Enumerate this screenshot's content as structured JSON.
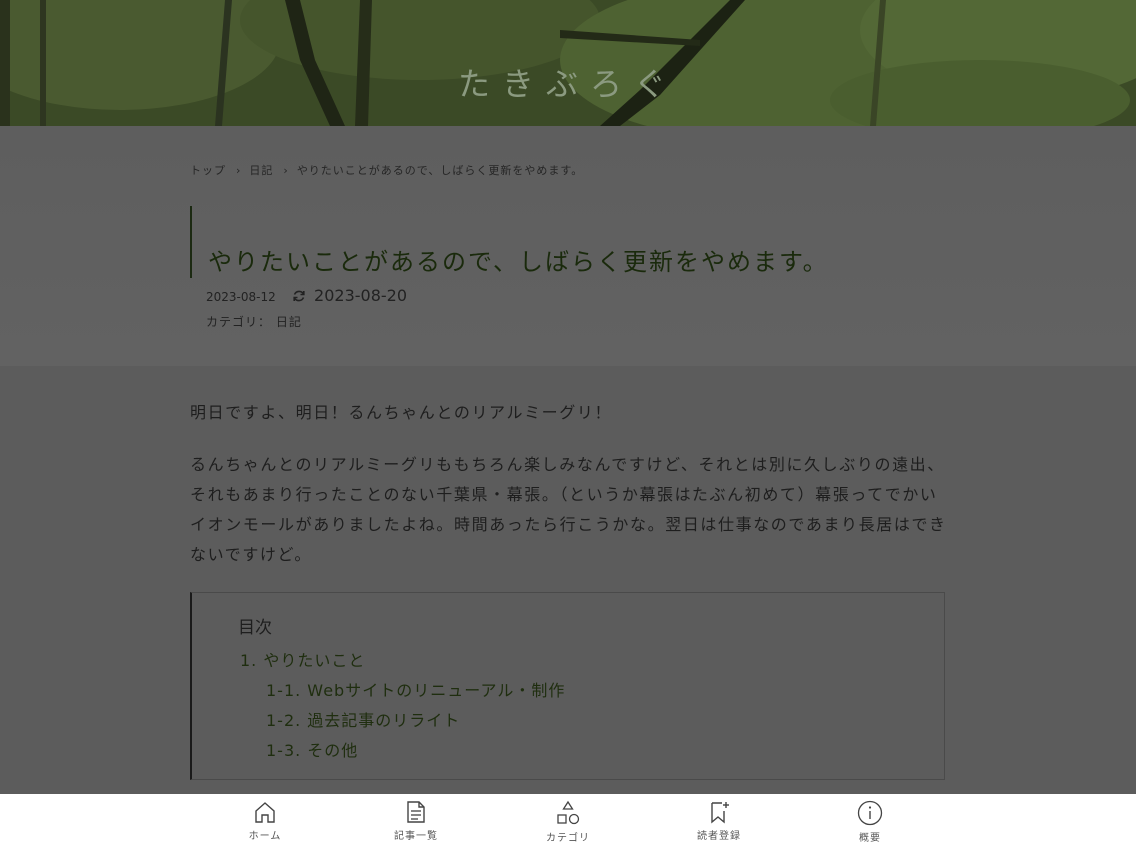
{
  "site": {
    "title": "たきぶろぐ"
  },
  "breadcrumb": {
    "top": "トップ",
    "category": "日記",
    "current": "やりたいことがあるので、しばらく更新をやめます。"
  },
  "post": {
    "title": "やりたいことがあるので、しばらく更新をやめます。",
    "published": "2023-08-12",
    "updated": "2023-08-20",
    "category_label": "カテゴリ：",
    "category": "日記",
    "paragraph1": "明日ですよ、明日！るんちゃんとのリアルミーグリ！",
    "paragraph2": "るんちゃんとのリアルミーグリももちろん楽しみなんですけど、それとは別に久しぶりの遠出、それもあまり行ったことのない千葉県・幕張。（というか幕張はたぶん初めて）幕張ってでかいイオンモールがありましたよね。時間あったら行こうかな。翌日は仕事なのであまり長居はできないですけど。"
  },
  "toc": {
    "title": "目次",
    "items": [
      "1. やりたいこと",
      "1-1. Webサイトのリニューアル・制作",
      "1-2. 過去記事のリライト",
      "1-3. その他"
    ]
  },
  "nav": {
    "home": "ホーム",
    "articles": "記事一覧",
    "category": "カテゴリ",
    "subscribe": "読者登録",
    "about": "概要"
  },
  "icons": [
    "refresh-icon",
    "home-icon",
    "document-icon",
    "shapes-icon",
    "bookmark-plus-icon",
    "info-icon"
  ],
  "colors": {
    "overlay": "#5c5c5c",
    "title_green": "#1a2a0c",
    "nav_bg": "#ffffff"
  }
}
